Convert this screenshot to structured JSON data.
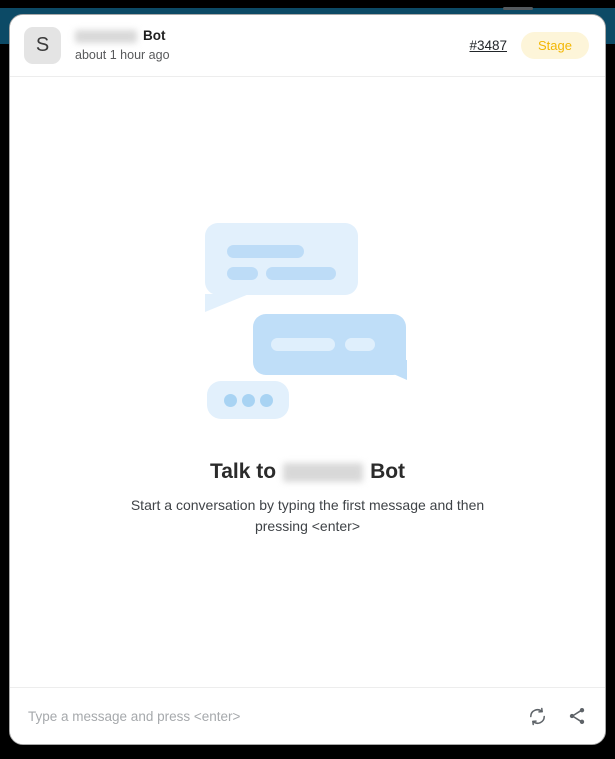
{
  "window": {
    "frame_accent_color": "#0c4a66",
    "outer_background_color": "#000000"
  },
  "header": {
    "avatar_letter": "S",
    "avatar_name": "avatar",
    "bot_name_redacted": "",
    "bot_suffix": "Bot",
    "timestamp": "about 1 hour ago",
    "ticket_link": "#3487",
    "stage_badge": "Stage",
    "stage_badge_color": "#f2b705",
    "stage_badge_background": "#fdf5d9"
  },
  "empty_state": {
    "title_prefix": "Talk to",
    "title_redacted": "",
    "title_suffix": "Bot",
    "subtitle": "Start a conversation by typing the first message and then pressing <enter>",
    "illustration": {
      "bubble_light_color": "#e2f0fc",
      "bubble_medium_color": "#bfdef8",
      "bar_color": "#bddcf7",
      "bar_light_color": "#dfeffc",
      "dot_color": "#a8d3f3",
      "dot_count": 3
    }
  },
  "composer": {
    "placeholder": "Type a message and press <enter>",
    "value": "",
    "refresh_icon": "refresh-icon",
    "share_icon": "share-icon"
  }
}
